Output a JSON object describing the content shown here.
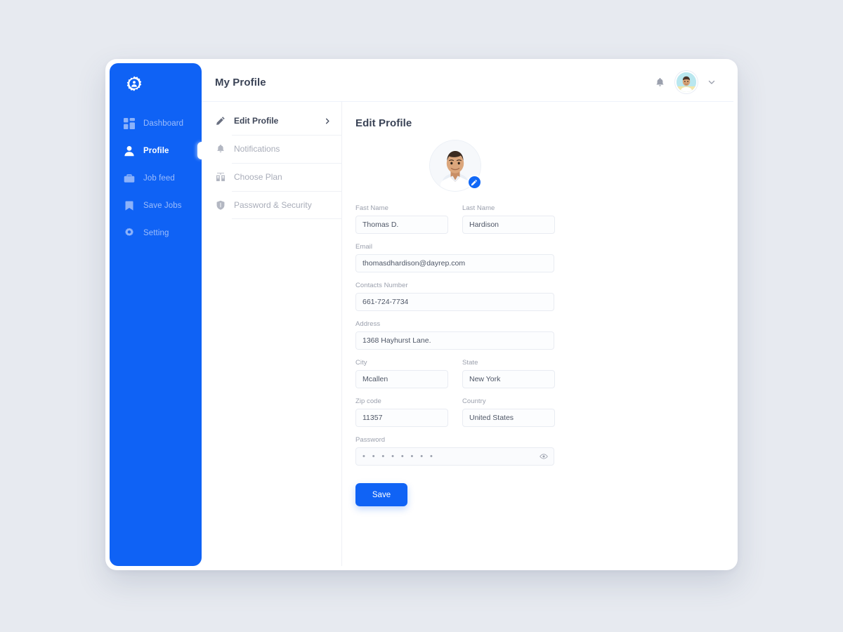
{
  "theme": {
    "accent": "#0f62f5",
    "page_bg": "#e7eaf0",
    "card_bg": "#ffffff",
    "muted_text": "#a9adb9",
    "heading_text": "#3a4356"
  },
  "sidebar": {
    "logo_icon": "gear-person-logo-icon",
    "items": [
      {
        "label": "Dashboard",
        "icon": "grid-icon",
        "active": false
      },
      {
        "label": "Profile",
        "icon": "user-icon",
        "active": true
      },
      {
        "label": "Job feed",
        "icon": "briefcase-icon",
        "active": false
      },
      {
        "label": "Save Jobs",
        "icon": "bookmark-icon",
        "active": false
      },
      {
        "label": "Setting",
        "icon": "gear-icon",
        "active": false
      }
    ]
  },
  "topbar": {
    "title": "My Profile",
    "bell_icon": "bell-icon",
    "avatar_icon": "avatar",
    "chevron_icon": "chevron-down-icon"
  },
  "settings_menu": {
    "items": [
      {
        "label": "Edit Profile",
        "icon": "pencil-icon",
        "active": true,
        "arrow": true
      },
      {
        "label": "Notifications",
        "icon": "bell-icon",
        "active": false,
        "arrow": false
      },
      {
        "label": "Choose Plan",
        "icon": "plan-icon",
        "active": false,
        "arrow": false
      },
      {
        "label": "Password & Security",
        "icon": "shield-icon",
        "active": false,
        "arrow": false
      }
    ]
  },
  "form": {
    "title": "Edit Profile",
    "photo": {
      "edit_badge_icon": "pencil-icon"
    },
    "first_name": {
      "label": "Fast Name",
      "value": "Thomas D."
    },
    "last_name": {
      "label": "Last Name",
      "value": "Hardison"
    },
    "email": {
      "label": "Email",
      "value": "thomasdhardison@dayrep.com"
    },
    "contacts": {
      "label": "Contacts Number",
      "value": "661-724-7734"
    },
    "address": {
      "label": "Address",
      "value": "1368  Hayhurst Lane."
    },
    "city": {
      "label": "City",
      "value": "Mcallen"
    },
    "state": {
      "label": "State",
      "value": "New York"
    },
    "zip": {
      "label": "Zip code",
      "value": "11357"
    },
    "country": {
      "label": "Country",
      "value": "United States"
    },
    "password": {
      "label": "Password",
      "value": "• • • • • • • •",
      "reveal_icon": "eye-icon"
    },
    "save_label": "Save"
  }
}
